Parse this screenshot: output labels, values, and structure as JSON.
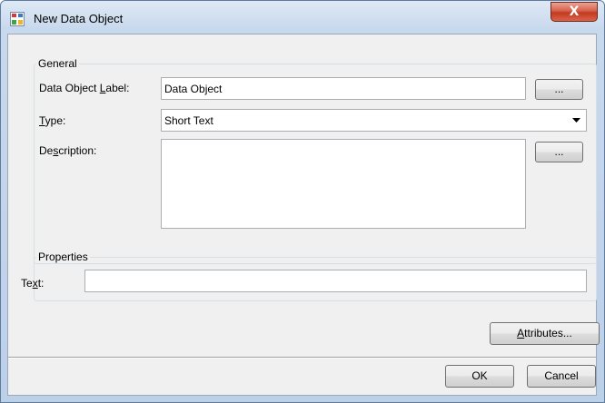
{
  "window": {
    "title": "New Data Object",
    "close_label": "X"
  },
  "general": {
    "legend": "General",
    "label_field": {
      "label_pre": "Data Object ",
      "label_accel": "L",
      "label_post": "abel:",
      "value": "Data Object",
      "browse": "..."
    },
    "type_field": {
      "label_accel": "T",
      "label_post": "ype:",
      "value": "Short Text",
      "options": [
        "Short Text"
      ]
    },
    "description_field": {
      "label_pre": "De",
      "label_accel": "s",
      "label_post": "cription:",
      "value": "",
      "browse": "..."
    }
  },
  "properties": {
    "legend": "Properties",
    "text_field": {
      "label_pre": "Te",
      "label_accel": "x",
      "label_post": "t:",
      "value": ""
    }
  },
  "buttons": {
    "attributes": {
      "accel": "A",
      "rest": "ttributes..."
    },
    "ok": "OK",
    "cancel": "Cancel"
  }
}
